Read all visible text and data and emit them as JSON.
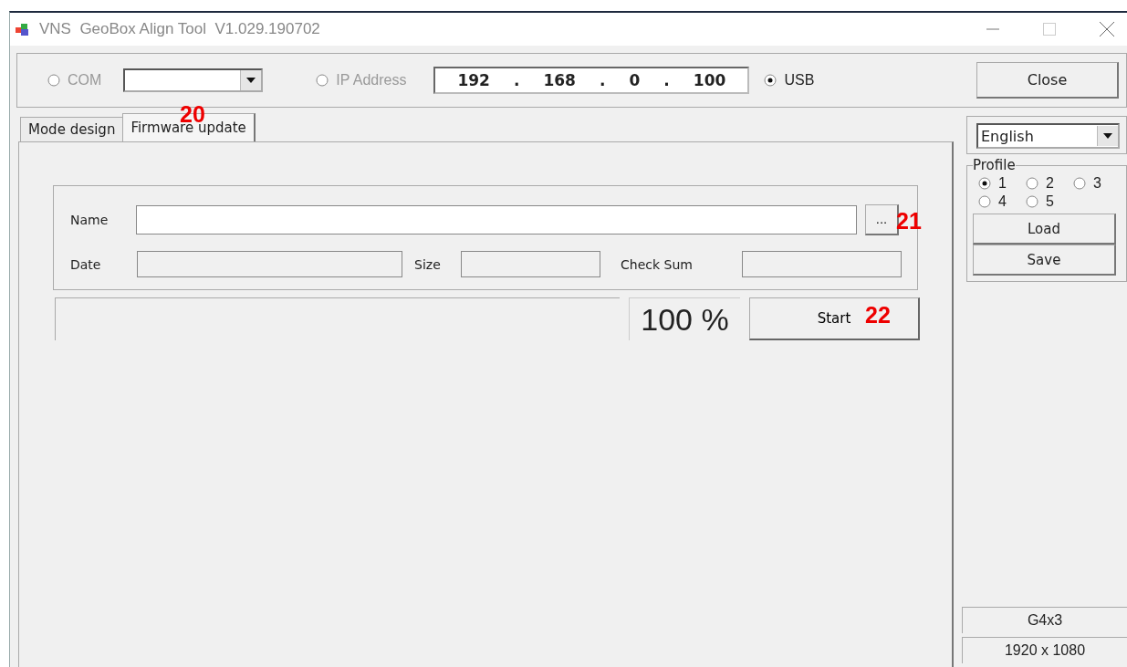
{
  "window": {
    "title": "VNS  GeoBox Align Tool  V1.029.190702"
  },
  "connection": {
    "options": [
      {
        "kind": "com",
        "label": "COM",
        "selected": false,
        "disabled": true
      },
      {
        "kind": "ip",
        "label": "IP Address",
        "selected": false,
        "disabled": true
      },
      {
        "kind": "usb",
        "label": "USB",
        "selected": true,
        "disabled": false
      }
    ],
    "ip_address": [
      "192",
      ".",
      "168",
      ".",
      "0",
      ".",
      "100"
    ],
    "close_button": "Close"
  },
  "tabs": [
    {
      "label": "Mode design",
      "selected": false
    },
    {
      "label": "Firmware update",
      "selected": true
    }
  ],
  "firmware": {
    "name_label": "Name",
    "browse_button": "...",
    "date_label": "Date",
    "size_label": "Size",
    "checksum_label": "Check Sum",
    "percent": "100 %",
    "start_button": "Start"
  },
  "side": {
    "language": "English",
    "profile": {
      "legend": "Profile",
      "options": [
        {
          "label": "1",
          "selected": true
        },
        {
          "label": "2",
          "selected": false
        },
        {
          "label": "3",
          "selected": false
        },
        {
          "label": "4",
          "selected": false
        },
        {
          "label": "5",
          "selected": false
        }
      ]
    },
    "load_button": "Load",
    "save_button": "Save",
    "status": [
      "G4x3",
      "1920 x 1080"
    ]
  },
  "callouts": [
    {
      "label": "20"
    },
    {
      "label": "21"
    },
    {
      "label": "22"
    }
  ]
}
